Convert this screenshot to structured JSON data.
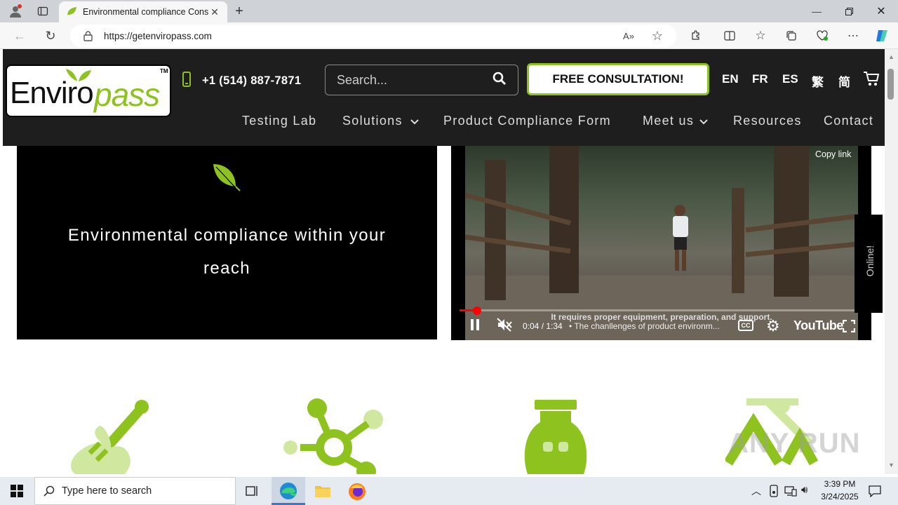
{
  "browser": {
    "tab_title": "Environmental compliance Cons",
    "url": "https://getenviropass.com",
    "new_tab_label": "+"
  },
  "header": {
    "logo_text_black": "Enviro",
    "logo_text_green": "pass",
    "logo_tm": "TM",
    "phone": "+1 (514) 887-7871",
    "search_placeholder": "Search...",
    "cta": "FREE CONSULTATION!",
    "languages": [
      "EN",
      "FR",
      "ES",
      "繁",
      "简"
    ]
  },
  "nav": {
    "items": [
      {
        "label": "Testing Lab"
      },
      {
        "label": "Solutions"
      },
      {
        "label": "Product Compliance Form"
      },
      {
        "label": "Meet us"
      },
      {
        "label": "Resources"
      },
      {
        "label": "Contact"
      }
    ]
  },
  "hero": {
    "tagline": "Environmental compliance within your reach"
  },
  "video": {
    "copy_link": "Copy link",
    "caption": "It requires proper equipment, preparation, and support.",
    "time": "0:04 / 1:34",
    "title": "• The chanllenges of product environm...",
    "brand": "YouTube",
    "online_tab": "Online!",
    "progress": 0.045
  },
  "taskbar": {
    "search_placeholder": "Type here to search",
    "time": "3:39 PM",
    "date": "3/24/2025"
  },
  "watermark": "ANY RUN",
  "colors": {
    "brand_green": "#8dc21f",
    "header_bg": "#1e1e1e"
  }
}
